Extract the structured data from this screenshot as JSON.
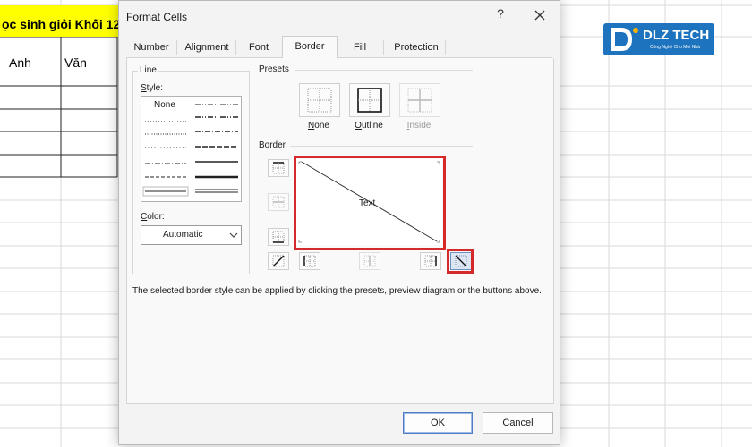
{
  "sheet": {
    "title_partial": "ọc sinh giỏi Khối 12",
    "columns": [
      "Anh",
      "Văn"
    ],
    "title_fill": "#ffff00"
  },
  "logo": {
    "brand": "DLZ TECH",
    "tagline": "Công Nghệ Cho Mọi Nhà",
    "color": "#1e73be"
  },
  "dialog": {
    "title": "Format Cells",
    "help_label": "?",
    "close_icon": "close-icon",
    "tabs": [
      {
        "label": "Number",
        "active": false
      },
      {
        "label": "Alignment",
        "active": false
      },
      {
        "label": "Font",
        "active": false
      },
      {
        "label": "Border",
        "active": true
      },
      {
        "label": "Fill",
        "active": false
      },
      {
        "label": "Protection",
        "active": false
      }
    ],
    "line": {
      "group_label": "Line",
      "style_label": "Style:",
      "style_access_key": "S",
      "style_rest": "tyle:",
      "none_label": "None",
      "color_label": "Color:",
      "color_access_key": "C",
      "color_rest": "olor:",
      "color_value": "Automatic"
    },
    "presets": {
      "group_label": "Presets",
      "items": [
        {
          "label": "None",
          "access_key": "N",
          "rest": "one",
          "enabled": true
        },
        {
          "label": "Outline",
          "access_key": "O",
          "rest": "utline",
          "enabled": true
        },
        {
          "label": "Inside",
          "access_key": "I",
          "rest": "nside",
          "enabled": false
        }
      ]
    },
    "border": {
      "group_label": "Border",
      "preview_text": "Text",
      "highlight_color": "#d62a2a"
    },
    "help_text": "The selected border style can be applied by clicking the presets, preview diagram or the buttons above.",
    "ok_label": "OK",
    "cancel_label": "Cancel"
  }
}
